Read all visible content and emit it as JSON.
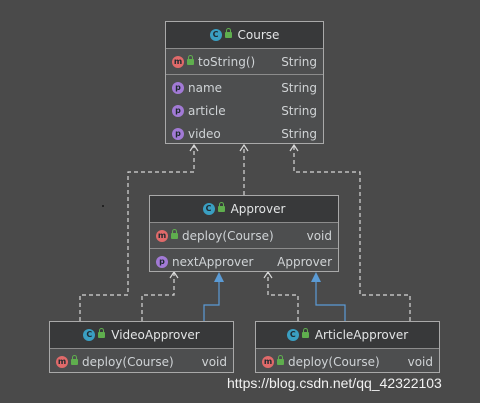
{
  "colors": {
    "background": "#4a4a4a",
    "dependency_line": "#d8d8d8",
    "inheritance_line": "#5b9bd5",
    "class_badge": "#3a9fc2",
    "method_badge": "#e06a6a",
    "property_badge": "#a27ad6",
    "visibility_lock": "#5fae4e"
  },
  "icons": {
    "class_badge": "C",
    "method_badge": "m",
    "property_badge": "p"
  },
  "classes": {
    "course": {
      "name": "Course",
      "methods": [
        {
          "name": "toString()",
          "type": "String"
        }
      ],
      "fields": [
        {
          "name": "name",
          "type": "String"
        },
        {
          "name": "article",
          "type": "String"
        },
        {
          "name": "video",
          "type": "String"
        }
      ]
    },
    "approver": {
      "name": "Approver",
      "methods": [
        {
          "name": "deploy(Course)",
          "type": "void"
        }
      ],
      "fields": [
        {
          "name": "nextApprover",
          "type": "Approver"
        }
      ]
    },
    "video_approver": {
      "name": "VideoApprover",
      "methods": [
        {
          "name": "deploy(Course)",
          "type": "void"
        }
      ]
    },
    "article_approver": {
      "name": "ArticleApprover",
      "methods": [
        {
          "name": "deploy(Course)",
          "type": "void"
        }
      ]
    }
  },
  "relations": [
    {
      "from": "approver",
      "to": "course",
      "kind": "dependency"
    },
    {
      "from": "video_approver",
      "to": "course",
      "kind": "dependency"
    },
    {
      "from": "article_approver",
      "to": "course",
      "kind": "dependency"
    },
    {
      "from": "video_approver",
      "to": "approver",
      "kind": "dependency"
    },
    {
      "from": "article_approver",
      "to": "approver",
      "kind": "dependency"
    },
    {
      "from": "video_approver",
      "to": "approver",
      "kind": "inheritance"
    },
    {
      "from": "article_approver",
      "to": "approver",
      "kind": "inheritance"
    }
  ],
  "watermark": "https://blog.csdn.net/qq_42322103"
}
